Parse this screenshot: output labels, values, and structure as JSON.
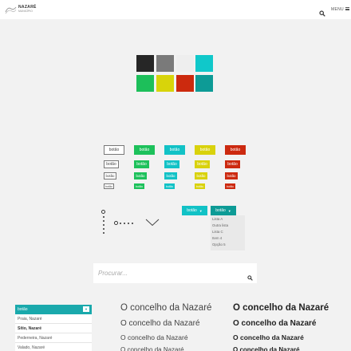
{
  "header": {
    "logo_title": "NAZARÉ",
    "logo_subtitle": "MUNICÍPIO",
    "menu_label": "MENU"
  },
  "palette": {
    "colors": [
      "#262626",
      "#7a7a7a",
      "#eeeeee",
      "#10c8ca",
      "#1dbf5a",
      "#d8d40a",
      "#cc2a0e",
      "#0d9b96"
    ]
  },
  "buttons": {
    "label": "botão",
    "colors": {
      "green": "#1dc15b",
      "teal": "#12c2c6",
      "yellow": "#d9d20c",
      "red": "#cc2a10"
    }
  },
  "dropdown": {
    "button_label": "botão",
    "menu_items": [
      "Lista A",
      "Outra lista",
      "Lista C",
      "Item 4",
      "Opção 5"
    ]
  },
  "search": {
    "placeholder": "Procurar..."
  },
  "side_list": {
    "header_label": "botão",
    "items": [
      {
        "label": "Praia, Nazaré",
        "bold": false
      },
      {
        "label": "Sítio, Nazaré",
        "bold": true
      },
      {
        "label": "Pederneira, Nazaré",
        "bold": false
      },
      {
        "label": "Valado, Nazaré",
        "bold": false
      }
    ]
  },
  "typography": {
    "sample": "O concelho da Nazaré"
  }
}
